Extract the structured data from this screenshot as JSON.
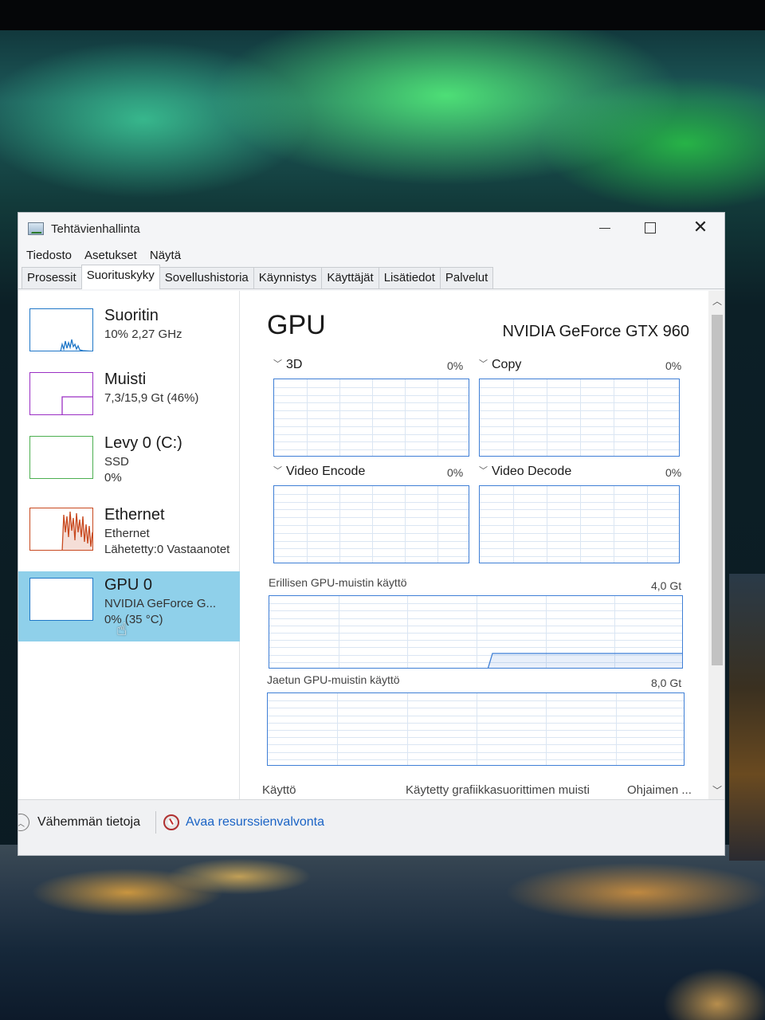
{
  "window": {
    "title": "Tehtävienhallinta",
    "controls": {
      "minimize": "—",
      "maximize": "☐",
      "close": "✕"
    }
  },
  "menu": [
    "Tiedosto",
    "Asetukset",
    "Näytä"
  ],
  "tabs": [
    "Prosessit",
    "Suorituskyky",
    "Sovellushistoria",
    "Käynnistys",
    "Käyttäjät",
    "Lisätiedot",
    "Palvelut"
  ],
  "active_tab": "Suorituskyky",
  "sidebar": {
    "items": [
      {
        "title": "Suoritin",
        "line1": "10% 2,27 GHz",
        "line2": "",
        "color": "#1f77c8",
        "icon": "cpu-graph"
      },
      {
        "title": "Muisti",
        "line1": "7,3/15,9 Gt (46%)",
        "line2": "",
        "color": "#9b2fc4",
        "icon": "memory-graph"
      },
      {
        "title": "Levy 0 (C:)",
        "line1": "SSD",
        "line2": "0%",
        "color": "#4caf50",
        "icon": "disk-graph"
      },
      {
        "title": "Ethernet",
        "line1": "Ethernet",
        "line2": "Lähetetty:0 Vastaanotet",
        "color": "#c8491f",
        "icon": "network-graph"
      },
      {
        "title": "GPU 0",
        "line1": "NVIDIA GeForce G...",
        "line2": "0% (35 °C)",
        "color": "#1f77c8",
        "icon": "gpu-graph",
        "selected": true
      }
    ]
  },
  "gpu": {
    "heading": "GPU",
    "name": "NVIDIA GeForce GTX 960",
    "engines": [
      {
        "label": "3D",
        "value": "0%"
      },
      {
        "label": "Copy",
        "value": "0%"
      },
      {
        "label": "Video Encode",
        "value": "0%"
      },
      {
        "label": "Video Decode",
        "value": "0%"
      }
    ],
    "dedicated_memory": {
      "label": "Erillisen GPU-muistin käyttö",
      "max": "4,0 Gt"
    },
    "shared_memory": {
      "label": "Jaetun GPU-muistin käyttö",
      "max": "8,0 Gt"
    },
    "bottom_columns": [
      "Käyttö",
      "Käytetty grafiikkasuorittimen muisti",
      "Ohjaimen ..."
    ]
  },
  "footer": {
    "fewer_details": "Vähemmän tietoja",
    "open_resource_monitor": "Avaa resurssienvalvonta"
  },
  "colors": {
    "accent": "#1a63c5",
    "graph_border": "#3f7fd6",
    "selected_bg": "#8fd0ea"
  }
}
